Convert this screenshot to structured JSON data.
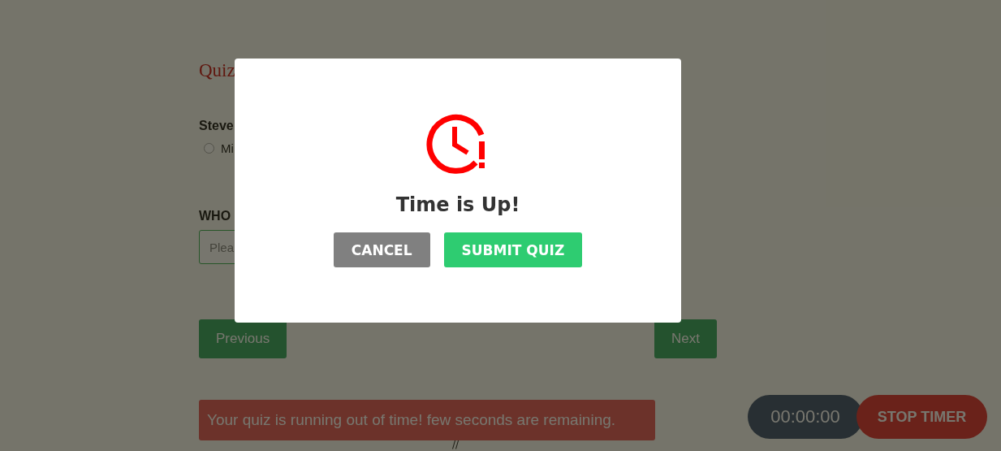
{
  "page": {
    "title": "Quiz",
    "question_1": {
      "text": "Steve",
      "options": [
        {
          "label": "Mi",
          "selected": false
        }
      ]
    },
    "question_2": {
      "text": "WHO",
      "answer": {
        "placeholder": "Plea"
      }
    },
    "buttons": [
      "Previous",
      "Next"
    ],
    "alert": "Your quiz is running out of time! few seconds are remaining.",
    "footer_mark": "//"
  },
  "timer": {
    "time": "00:00:00",
    "button": "STOP TIMER"
  },
  "modal": {
    "title": "Time is Up!",
    "buttons": [
      {
        "label": "CANCEL",
        "kind": "secondary"
      },
      {
        "label": "SUBMIT QUIZ",
        "kind": "primary"
      }
    ]
  }
}
